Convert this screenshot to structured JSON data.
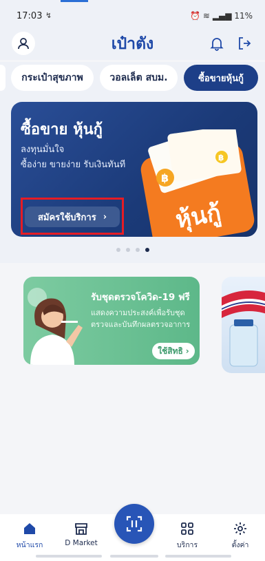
{
  "status_bar": {
    "time": "17:03",
    "time_extra": "↯",
    "battery": "11%"
  },
  "header": {
    "title": "เป๋าตัง"
  },
  "icons": {
    "profile": "person-icon",
    "bell": "bell-icon",
    "logout": "logout-icon"
  },
  "tabs": [
    {
      "label": ""
    },
    {
      "label": "กระเป๋าสุขภาพ"
    },
    {
      "label": "วอลเล็ต สบม."
    },
    {
      "label": "ซื้อขายหุ้นกู้",
      "active": true
    }
  ],
  "banner": {
    "title": "ซื้อขาย หุ้นกู้",
    "line1": "ลงทุนมั่นใจ",
    "line2": "ซื้อง่าย ขายง่าย รับเงินทันที",
    "cta_label": "สมัครใช้บริการ",
    "art_text": "หุ้นกู้",
    "page_count": 4,
    "active_page": 4
  },
  "promo": {
    "title": "รับชุดตรวจโควิด-19 ฟรี",
    "description": "แสดงความประสงค์เพื่อรับชุดตรวจและบันทึกผลตรวจอาการ",
    "button_label": "ใช้สิทธิ"
  },
  "bottom_nav": {
    "items": [
      {
        "label": "หน้าแรก",
        "icon": "home-icon",
        "active": true
      },
      {
        "label": "D Market",
        "icon": "market-icon"
      },
      {
        "label": "บริการ",
        "icon": "grid-icon"
      },
      {
        "label": "ตั้งค่า",
        "icon": "gear-icon"
      }
    ]
  },
  "colors": {
    "brand": "#1f49a8",
    "active_tab": "#1d3f88",
    "promo_green": "#5db889",
    "highlight": "#e61c24"
  }
}
